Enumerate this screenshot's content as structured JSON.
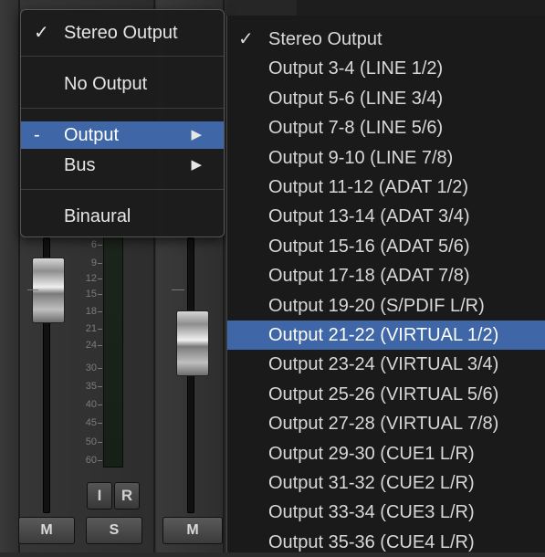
{
  "colors": {
    "highlight": "#3f67a7",
    "menu_bg": "#1c1c1c",
    "text": "#e6e6e6"
  },
  "context_menu": {
    "items": [
      {
        "check": "✓",
        "label": "Stereo Output",
        "submenu": false
      },
      {
        "check": "",
        "label": "No Output",
        "submenu": false
      },
      {
        "check": "-",
        "label": "Output",
        "submenu": true,
        "highlighted": true
      },
      {
        "check": "",
        "label": "Bus",
        "submenu": true
      },
      {
        "check": "",
        "label": "Binaural",
        "submenu": false
      }
    ],
    "arrow_icon": "▶"
  },
  "output_submenu": {
    "items": [
      {
        "check": "✓",
        "label": "Stereo Output"
      },
      {
        "check": "",
        "label": "Output 3-4  (LINE 1/2)"
      },
      {
        "check": "",
        "label": "Output 5-6  (LINE 3/4)"
      },
      {
        "check": "",
        "label": "Output 7-8  (LINE 5/6)"
      },
      {
        "check": "",
        "label": "Output 9-10  (LINE 7/8)"
      },
      {
        "check": "",
        "label": "Output 11-12  (ADAT 1/2)"
      },
      {
        "check": "",
        "label": "Output 13-14  (ADAT 3/4)"
      },
      {
        "check": "",
        "label": "Output 15-16  (ADAT 5/6)"
      },
      {
        "check": "",
        "label": "Output 17-18  (ADAT 7/8)"
      },
      {
        "check": "",
        "label": "Output 19-20  (S/PDIF L/R)"
      },
      {
        "check": "",
        "label": "Output 21-22  (VIRTUAL 1/2)",
        "highlighted": true
      },
      {
        "check": "",
        "label": "Output 23-24  (VIRTUAL 3/4)"
      },
      {
        "check": "",
        "label": "Output 25-26  (VIRTUAL 5/6)"
      },
      {
        "check": "",
        "label": "Output 27-28  (VIRTUAL 7/8)"
      },
      {
        "check": "",
        "label": "Output 29-30  (CUE1 L/R)"
      },
      {
        "check": "",
        "label": "Output 31-32  (CUE2 L/R)"
      },
      {
        "check": "",
        "label": "Output 33-34  (CUE3 L/R)"
      },
      {
        "check": "",
        "label": "Output 35-36  (CUE4 L/R)"
      }
    ]
  },
  "mixer": {
    "fader_scale": [
      "6",
      "9",
      "12",
      "15",
      "18",
      "21",
      "24",
      "30",
      "35",
      "40",
      "45",
      "50",
      "60"
    ],
    "strip1": {
      "mute": "M"
    },
    "strip2": {
      "input": "I",
      "record": "R",
      "solo": "S"
    },
    "strip3": {
      "mute": "M"
    }
  }
}
